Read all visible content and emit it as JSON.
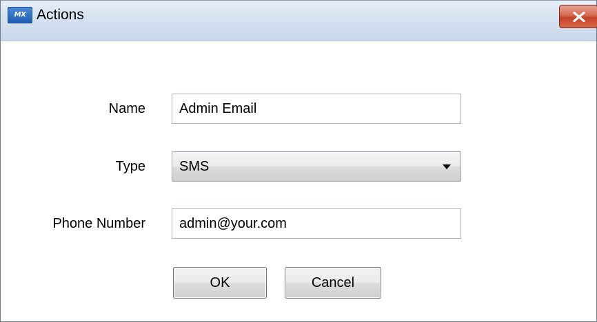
{
  "window": {
    "title": "Actions",
    "app_icon": "MX"
  },
  "form": {
    "name_label": "Name",
    "name_value": "Admin Email",
    "type_label": "Type",
    "type_value": "SMS",
    "phone_label": "Phone Number",
    "phone_value": "admin@your.com"
  },
  "buttons": {
    "ok_label": "OK",
    "cancel_label": "Cancel"
  },
  "icons": {
    "app": "app-logo-icon",
    "close": "close-icon",
    "dropdown": "chevron-down-icon"
  },
  "colors": {
    "titlebar": "#d6e2f1",
    "close_button": "#c44227",
    "content_background": "#ffffff"
  }
}
